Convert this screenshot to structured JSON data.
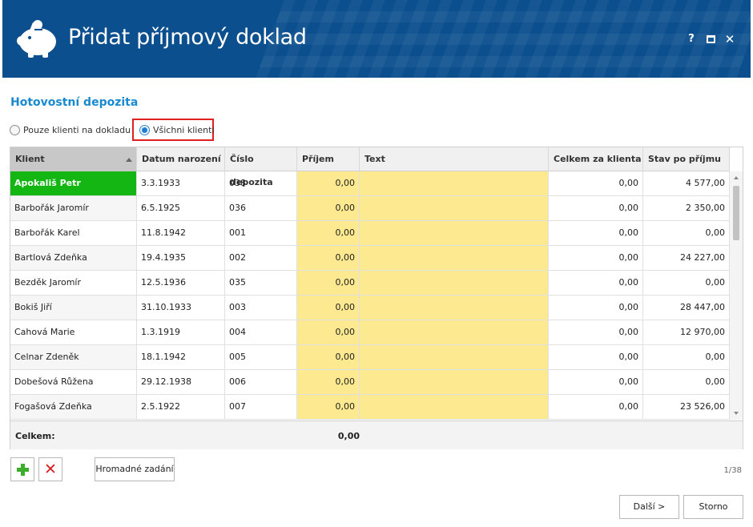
{
  "window": {
    "title": "Přidat příjmový doklad",
    "help_label": "?",
    "close_label": "✕"
  },
  "section": {
    "title": "Hotovostní depozita"
  },
  "filter": {
    "options": [
      "Pouze klienti na dokladu",
      "Všichni klienti"
    ],
    "selected": "Všichni klienti"
  },
  "table": {
    "columns": [
      "Klient",
      "Datum narození",
      "Číslo depozita",
      "Příjem",
      "Text",
      "Celkem za klienta",
      "Stav po příjmu"
    ],
    "sorted_column": "Klient",
    "selected_row": 0,
    "rows": [
      {
        "client": "Apokališ Petr",
        "dob": "3.3.1933",
        "deposit": "038",
        "income": "0,00",
        "text": "",
        "total": "0,00",
        "balance": "4 577,00"
      },
      {
        "client": "Barbořák Jaromír",
        "dob": "6.5.1925",
        "deposit": "036",
        "income": "0,00",
        "text": "",
        "total": "0,00",
        "balance": "2 350,00"
      },
      {
        "client": "Barbořák Karel",
        "dob": "11.8.1942",
        "deposit": "001",
        "income": "0,00",
        "text": "",
        "total": "0,00",
        "balance": "0,00"
      },
      {
        "client": "Bartlová Zdeňka",
        "dob": "19.4.1935",
        "deposit": "002",
        "income": "0,00",
        "text": "",
        "total": "0,00",
        "balance": "24 227,00"
      },
      {
        "client": "Bezděk Jaromír",
        "dob": "12.5.1936",
        "deposit": "035",
        "income": "0,00",
        "text": "",
        "total": "0,00",
        "balance": "0,00"
      },
      {
        "client": "Bokiš Jiří",
        "dob": "31.10.1933",
        "deposit": "003",
        "income": "0,00",
        "text": "",
        "total": "0,00",
        "balance": "28 447,00"
      },
      {
        "client": "Cahová Marie",
        "dob": "1.3.1919",
        "deposit": "004",
        "income": "0,00",
        "text": "",
        "total": "0,00",
        "balance": "12 970,00"
      },
      {
        "client": "Celnar Zdeněk",
        "dob": "18.1.1942",
        "deposit": "005",
        "income": "0,00",
        "text": "",
        "total": "0,00",
        "balance": "0,00"
      },
      {
        "client": "Dobešová Růžena",
        "dob": "29.12.1938",
        "deposit": "006",
        "income": "0,00",
        "text": "",
        "total": "0,00",
        "balance": "0,00"
      },
      {
        "client": "Fogašová Zdeňka",
        "dob": "2.5.1922",
        "deposit": "007",
        "income": "0,00",
        "text": "",
        "total": "0,00",
        "balance": "23 526,00"
      }
    ],
    "footer": {
      "label": "Celkem:",
      "income_total": "0,00"
    }
  },
  "actions": {
    "add_icon": "plus-icon",
    "delete_icon": "delete-icon",
    "delete_glyph": "✕",
    "bulk_label": "Hromadné zadání",
    "pager": "1/38",
    "next_label": "Další >",
    "cancel_label": "Storno"
  },
  "colors": {
    "header_bg": "#0b4f8e",
    "accent": "#1a8ad0",
    "selected_client": "#13b613",
    "income_cell": "#fde98f",
    "highlight": "#e02020"
  }
}
